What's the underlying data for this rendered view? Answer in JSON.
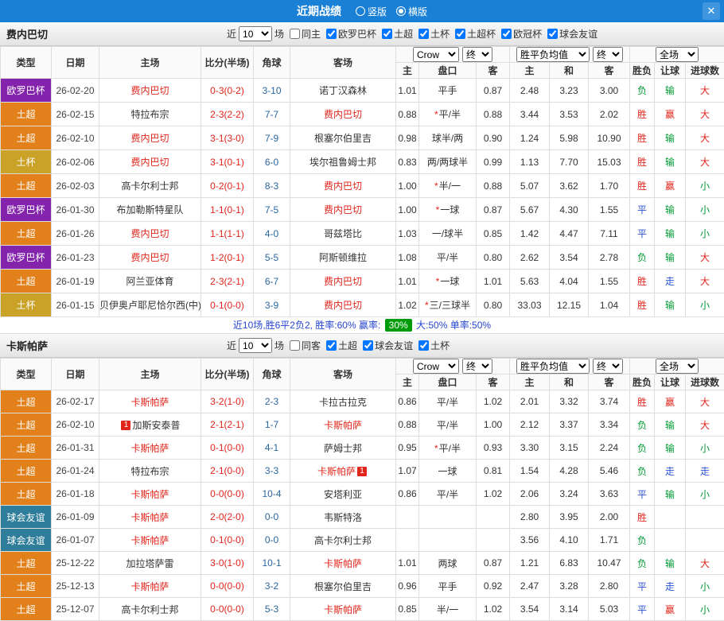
{
  "topbar": {
    "title": "近期战绩",
    "view_options": [
      {
        "label": "竖版",
        "selected": false
      },
      {
        "label": "横版",
        "selected": true
      }
    ],
    "close_icon": "✕"
  },
  "colors": {
    "league": {
      "欧罗巴杯": "#8424ad",
      "土超": "#e2811c",
      "土杯": "#c9a227",
      "球会友谊": "#2e7d9a"
    },
    "result": {
      "胜": "#e1251b",
      "负": "#009933",
      "平": "#2b52d4",
      "赢": "#e1251b",
      "输": "#009933",
      "走": "#2b52d4",
      "大": "#e1251b",
      "小": "#009933"
    },
    "team_highlight": "#e1251b",
    "badge_bg": "#009b09"
  },
  "table_header": {
    "cols": [
      "类型",
      "日期",
      "主场",
      "比分(半场)",
      "角球",
      "客场"
    ],
    "odds_group": {
      "source_select": "Crow",
      "final_select": "终",
      "cols": [
        "主",
        "盘口",
        "客"
      ]
    },
    "avg_group": {
      "label_select": "胜平负均值",
      "final_select": "终",
      "cols": [
        "主",
        "和",
        "客"
      ]
    },
    "full_group": {
      "select": "全场",
      "cols": [
        "胜负",
        "让球",
        "进球数"
      ]
    }
  },
  "sections": [
    {
      "team": "费内巴切",
      "filter": {
        "near": "近",
        "count": "10",
        "unit": "场",
        "same": {
          "label": "同主",
          "checked": false
        },
        "leagues": [
          {
            "label": "欧罗巴杯",
            "checked": true
          },
          {
            "label": "土超",
            "checked": true
          },
          {
            "label": "土杯",
            "checked": true
          },
          {
            "label": "土超杯",
            "checked": true
          },
          {
            "label": "欧冠杯",
            "checked": true
          },
          {
            "label": "球会友谊",
            "checked": true
          }
        ]
      },
      "rows": [
        {
          "league": "欧罗巴杯",
          "date": "26-02-20",
          "home": "费内巴切",
          "home_hl": true,
          "score": "0-3(0-2)",
          "corner": "3-10",
          "away": "诺丁汉森林",
          "away_hl": false,
          "odds_home": "1.01",
          "handicap": "平手",
          "handicap_star": false,
          "odds_away": "0.87",
          "avg_home": "2.48",
          "avg_draw": "3.23",
          "avg_away": "3.00",
          "wdl": "负",
          "handicap_result": "输",
          "goal_result": "大"
        },
        {
          "league": "土超",
          "date": "26-02-15",
          "home": "特拉布宗",
          "home_hl": false,
          "score": "2-3(2-2)",
          "corner": "7-7",
          "away": "费内巴切",
          "away_hl": true,
          "odds_home": "0.88",
          "handicap": "平/半",
          "handicap_star": true,
          "odds_away": "0.88",
          "avg_home": "3.44",
          "avg_draw": "3.53",
          "avg_away": "2.02",
          "wdl": "胜",
          "handicap_result": "赢",
          "goal_result": "大"
        },
        {
          "league": "土超",
          "date": "26-02-10",
          "home": "费内巴切",
          "home_hl": true,
          "score": "3-1(3-0)",
          "corner": "7-9",
          "away": "根塞尔伯里吉",
          "away_hl": false,
          "odds_home": "0.98",
          "handicap": "球半/两",
          "handicap_star": false,
          "odds_away": "0.90",
          "avg_home": "1.24",
          "avg_draw": "5.98",
          "avg_away": "10.90",
          "wdl": "胜",
          "handicap_result": "输",
          "goal_result": "大"
        },
        {
          "league": "土杯",
          "date": "26-02-06",
          "home": "费内巴切",
          "home_hl": true,
          "score": "3-1(0-1)",
          "corner": "6-0",
          "away": "埃尔祖鲁姆士邦",
          "away_hl": false,
          "odds_home": "0.83",
          "handicap": "两/两球半",
          "handicap_star": false,
          "odds_away": "0.99",
          "avg_home": "1.13",
          "avg_draw": "7.70",
          "avg_away": "15.03",
          "wdl": "胜",
          "handicap_result": "输",
          "goal_result": "大"
        },
        {
          "league": "土超",
          "date": "26-02-03",
          "home": "高卡尔利士邦",
          "home_hl": false,
          "score": "0-2(0-1)",
          "corner": "8-3",
          "away": "费内巴切",
          "away_hl": true,
          "odds_home": "1.00",
          "handicap": "半/一",
          "handicap_star": true,
          "odds_away": "0.88",
          "avg_home": "5.07",
          "avg_draw": "3.62",
          "avg_away": "1.70",
          "wdl": "胜",
          "handicap_result": "赢",
          "goal_result": "小"
        },
        {
          "league": "欧罗巴杯",
          "date": "26-01-30",
          "home": "布加勒斯特星队",
          "home_hl": false,
          "score": "1-1(0-1)",
          "corner": "7-5",
          "away": "费内巴切",
          "away_hl": true,
          "odds_home": "1.00",
          "handicap": "一球",
          "handicap_star": true,
          "odds_away": "0.87",
          "avg_home": "5.67",
          "avg_draw": "4.30",
          "avg_away": "1.55",
          "wdl": "平",
          "handicap_result": "输",
          "goal_result": "小"
        },
        {
          "league": "土超",
          "date": "26-01-26",
          "home": "费内巴切",
          "home_hl": true,
          "score": "1-1(1-1)",
          "corner": "4-0",
          "away": "哥兹塔比",
          "away_hl": false,
          "odds_home": "1.03",
          "handicap": "一/球半",
          "handicap_star": false,
          "odds_away": "0.85",
          "avg_home": "1.42",
          "avg_draw": "4.47",
          "avg_away": "7.11",
          "wdl": "平",
          "handicap_result": "输",
          "goal_result": "小"
        },
        {
          "league": "欧罗巴杯",
          "date": "26-01-23",
          "home": "费内巴切",
          "home_hl": true,
          "score": "1-2(0-1)",
          "corner": "5-5",
          "away": "阿斯顿维拉",
          "away_hl": false,
          "odds_home": "1.08",
          "handicap": "平/半",
          "handicap_star": false,
          "odds_away": "0.80",
          "avg_home": "2.62",
          "avg_draw": "3.54",
          "avg_away": "2.78",
          "wdl": "负",
          "handicap_result": "输",
          "goal_result": "大"
        },
        {
          "league": "土超",
          "date": "26-01-19",
          "home": "阿兰亚体育",
          "home_hl": false,
          "score": "2-3(2-1)",
          "corner": "6-7",
          "away": "费内巴切",
          "away_hl": true,
          "odds_home": "1.01",
          "handicap": "一球",
          "handicap_star": true,
          "odds_away": "1.01",
          "avg_home": "5.63",
          "avg_draw": "4.04",
          "avg_away": "1.55",
          "wdl": "胜",
          "handicap_result": "走",
          "goal_result": "大"
        },
        {
          "league": "土杯",
          "date": "26-01-15",
          "home": "贝伊奥卢耶尼恰尔西(中)",
          "home_hl": false,
          "score": "0-1(0-0)",
          "corner": "3-9",
          "away": "费内巴切",
          "away_hl": true,
          "odds_home": "1.02",
          "handicap": "三/三球半",
          "handicap_star": true,
          "odds_away": "0.80",
          "avg_home": "33.03",
          "avg_draw": "12.15",
          "avg_away": "1.04",
          "wdl": "胜",
          "handicap_result": "输",
          "goal_result": "小"
        }
      ],
      "summary": {
        "prefix": "近10场,胜6平2负2, 胜率:60% 赢率: ",
        "badge": "30%",
        "suffix": " 大:50% 单率:50%"
      }
    },
    {
      "team": "卡斯帕萨",
      "filter": {
        "near": "近",
        "count": "10",
        "unit": "场",
        "same": {
          "label": "同客",
          "checked": false
        },
        "leagues": [
          {
            "label": "土超",
            "checked": true
          },
          {
            "label": "球会友谊",
            "checked": true
          },
          {
            "label": "土杯",
            "checked": true
          }
        ]
      },
      "rows": [
        {
          "league": "土超",
          "date": "26-02-17",
          "home": "卡斯帕萨",
          "home_hl": true,
          "score": "3-2(1-0)",
          "corner": "2-3",
          "away": "卡拉古拉克",
          "away_hl": false,
          "odds_home": "0.86",
          "handicap": "平/半",
          "handicap_star": false,
          "odds_away": "1.02",
          "avg_home": "2.01",
          "avg_draw": "3.32",
          "avg_away": "3.74",
          "wdl": "胜",
          "handicap_result": "赢",
          "goal_result": "大"
        },
        {
          "league": "土超",
          "date": "26-02-10",
          "home": "加斯安泰普",
          "home_hl": false,
          "home_badge_pre": "1",
          "score": "2-1(2-1)",
          "corner": "1-7",
          "away": "卡斯帕萨",
          "away_hl": true,
          "odds_home": "0.88",
          "handicap": "平/半",
          "handicap_star": false,
          "odds_away": "1.00",
          "avg_home": "2.12",
          "avg_draw": "3.37",
          "avg_away": "3.34",
          "wdl": "负",
          "handicap_result": "输",
          "goal_result": "大"
        },
        {
          "league": "土超",
          "date": "26-01-31",
          "home": "卡斯帕萨",
          "home_hl": true,
          "score": "0-1(0-0)",
          "corner": "4-1",
          "away": "萨姆士邦",
          "away_hl": false,
          "odds_home": "0.95",
          "handicap": "平/半",
          "handicap_star": true,
          "odds_away": "0.93",
          "avg_home": "3.30",
          "avg_draw": "3.15",
          "avg_away": "2.24",
          "wdl": "负",
          "handicap_result": "输",
          "goal_result": "小"
        },
        {
          "league": "土超",
          "date": "26-01-24",
          "home": "特拉布宗",
          "home_hl": false,
          "score": "2-1(0-0)",
          "corner": "3-3",
          "away": "卡斯帕萨",
          "away_hl": true,
          "away_badge_post": "1",
          "odds_home": "1.07",
          "handicap": "一球",
          "handicap_star": false,
          "odds_away": "0.81",
          "avg_home": "1.54",
          "avg_draw": "4.28",
          "avg_away": "5.46",
          "wdl": "负",
          "handicap_result": "走",
          "goal_result": "走"
        },
        {
          "league": "土超",
          "date": "26-01-18",
          "home": "卡斯帕萨",
          "home_hl": true,
          "score": "0-0(0-0)",
          "corner": "10-4",
          "away": "安塔利亚",
          "away_hl": false,
          "odds_home": "0.86",
          "handicap": "平/半",
          "handicap_star": false,
          "odds_away": "1.02",
          "avg_home": "2.06",
          "avg_draw": "3.24",
          "avg_away": "3.63",
          "wdl": "平",
          "handicap_result": "输",
          "goal_result": "小"
        },
        {
          "league": "球会友谊",
          "date": "26-01-09",
          "home": "卡斯帕萨",
          "home_hl": true,
          "score": "2-0(2-0)",
          "corner": "0-0",
          "away": "韦斯特洛",
          "away_hl": false,
          "odds_home": "",
          "handicap": "",
          "handicap_star": false,
          "odds_away": "",
          "avg_home": "2.80",
          "avg_draw": "3.95",
          "avg_away": "2.00",
          "wdl": "胜",
          "handicap_result": "",
          "goal_result": ""
        },
        {
          "league": "球会友谊",
          "date": "26-01-07",
          "home": "卡斯帕萨",
          "home_hl": true,
          "score": "0-1(0-0)",
          "corner": "0-0",
          "away": "高卡尔利士邦",
          "away_hl": false,
          "odds_home": "",
          "handicap": "",
          "handicap_star": false,
          "odds_away": "",
          "avg_home": "3.56",
          "avg_draw": "4.10",
          "avg_away": "1.71",
          "wdl": "负",
          "handicap_result": "",
          "goal_result": ""
        },
        {
          "league": "土超",
          "date": "25-12-22",
          "home": "加拉塔萨雷",
          "home_hl": false,
          "score": "3-0(1-0)",
          "corner": "10-1",
          "away": "卡斯帕萨",
          "away_hl": true,
          "odds_home": "1.01",
          "handicap": "两球",
          "handicap_star": false,
          "odds_away": "0.87",
          "avg_home": "1.21",
          "avg_draw": "6.83",
          "avg_away": "10.47",
          "wdl": "负",
          "handicap_result": "输",
          "goal_result": "大"
        },
        {
          "league": "土超",
          "date": "25-12-13",
          "home": "卡斯帕萨",
          "home_hl": true,
          "score": "0-0(0-0)",
          "corner": "3-2",
          "away": "根塞尔伯里吉",
          "away_hl": false,
          "odds_home": "0.96",
          "handicap": "平手",
          "handicap_star": false,
          "odds_away": "0.92",
          "avg_home": "2.47",
          "avg_draw": "3.28",
          "avg_away": "2.80",
          "wdl": "平",
          "handicap_result": "走",
          "goal_result": "小"
        },
        {
          "league": "土超",
          "date": "25-12-07",
          "home": "高卡尔利士邦",
          "home_hl": false,
          "score": "0-0(0-0)",
          "corner": "5-3",
          "away": "卡斯帕萨",
          "away_hl": true,
          "odds_home": "0.85",
          "handicap": "半/一",
          "handicap_star": false,
          "odds_away": "1.02",
          "avg_home": "3.54",
          "avg_draw": "3.14",
          "avg_away": "5.03",
          "wdl": "平",
          "handicap_result": "赢",
          "goal_result": "小"
        }
      ]
    }
  ]
}
